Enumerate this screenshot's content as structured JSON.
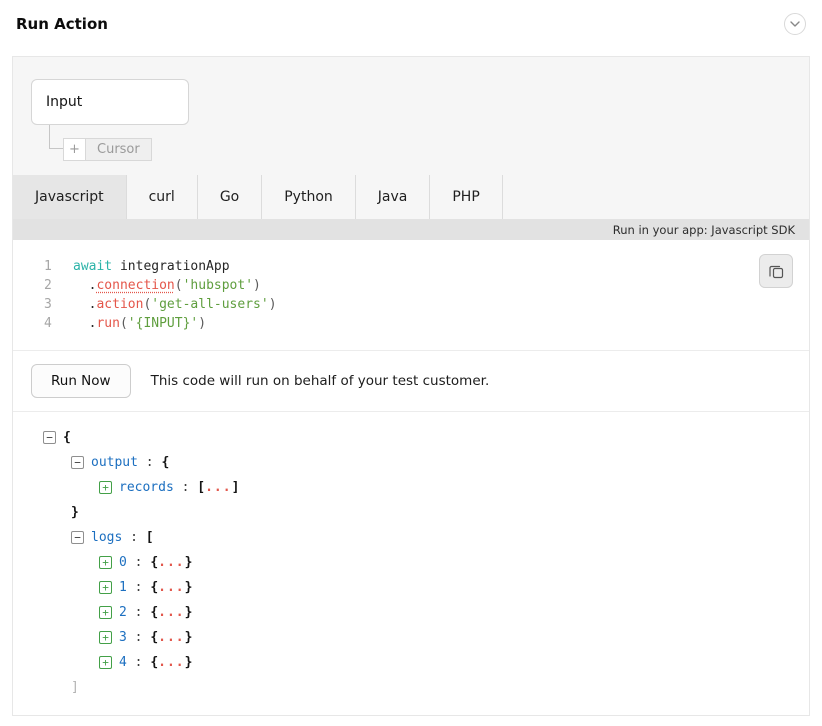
{
  "header": {
    "title": "Run Action"
  },
  "flow": {
    "input_label": "Input",
    "cursor_plus": "+",
    "cursor_label": "Cursor"
  },
  "tabs": [
    {
      "label": "Javascript",
      "active": true
    },
    {
      "label": "curl",
      "active": false
    },
    {
      "label": "Go",
      "active": false
    },
    {
      "label": "Python",
      "active": false
    },
    {
      "label": "Java",
      "active": false
    },
    {
      "label": "PHP",
      "active": false
    }
  ],
  "sdk_bar": {
    "label": "Run in your app: Javascript SDK"
  },
  "code": {
    "lines": [
      {
        "num": "1",
        "tokens": [
          {
            "type": "keyword",
            "text": "await "
          },
          {
            "type": "plain",
            "text": "integrationApp"
          }
        ]
      },
      {
        "num": "2",
        "tokens": [
          {
            "type": "plain",
            "text": "  ."
          },
          {
            "type": "method-underline",
            "text": "connection"
          },
          {
            "type": "punct",
            "text": "("
          },
          {
            "type": "string",
            "text": "'hubspot'"
          },
          {
            "type": "punct",
            "text": ")"
          }
        ]
      },
      {
        "num": "3",
        "tokens": [
          {
            "type": "plain",
            "text": "  ."
          },
          {
            "type": "method",
            "text": "action"
          },
          {
            "type": "punct",
            "text": "("
          },
          {
            "type": "string",
            "text": "'get-all-users'"
          },
          {
            "type": "punct",
            "text": ")"
          }
        ]
      },
      {
        "num": "4",
        "tokens": [
          {
            "type": "plain",
            "text": "  ."
          },
          {
            "type": "method",
            "text": "run"
          },
          {
            "type": "punct",
            "text": "("
          },
          {
            "type": "string",
            "text": "'{INPUT}'"
          },
          {
            "type": "punct",
            "text": ")"
          }
        ]
      }
    ]
  },
  "run": {
    "button_label": "Run Now",
    "note": "This code will run on behalf of your test customer."
  },
  "result_tree": {
    "rows": [
      {
        "indent": 0,
        "toggle": "minus",
        "segments": [
          {
            "type": "brace",
            "text": "{"
          }
        ]
      },
      {
        "indent": 1,
        "toggle": "minus",
        "segments": [
          {
            "type": "key",
            "text": "output"
          },
          {
            "type": "colon",
            "text": " : "
          },
          {
            "type": "brace",
            "text": "{"
          }
        ]
      },
      {
        "indent": 2,
        "toggle": "plus",
        "segments": [
          {
            "type": "key",
            "text": "records"
          },
          {
            "type": "colon",
            "text": " : "
          },
          {
            "type": "brace",
            "text": "["
          },
          {
            "type": "dots",
            "text": "..."
          },
          {
            "type": "brace",
            "text": "]"
          }
        ]
      },
      {
        "indent": 1,
        "toggle": "none",
        "segments": [
          {
            "type": "brace",
            "text": "}"
          }
        ]
      },
      {
        "indent": 1,
        "toggle": "minus",
        "segments": [
          {
            "type": "key",
            "text": "logs"
          },
          {
            "type": "colon",
            "text": " : "
          },
          {
            "type": "brace",
            "text": "["
          }
        ]
      },
      {
        "indent": 2,
        "toggle": "plus",
        "segments": [
          {
            "type": "key",
            "text": "0"
          },
          {
            "type": "colon",
            "text": " : "
          },
          {
            "type": "brace",
            "text": "{"
          },
          {
            "type": "dots",
            "text": "..."
          },
          {
            "type": "brace",
            "text": "}"
          }
        ]
      },
      {
        "indent": 2,
        "toggle": "plus",
        "segments": [
          {
            "type": "key",
            "text": "1"
          },
          {
            "type": "colon",
            "text": " : "
          },
          {
            "type": "brace",
            "text": "{"
          },
          {
            "type": "dots",
            "text": "..."
          },
          {
            "type": "brace",
            "text": "}"
          }
        ]
      },
      {
        "indent": 2,
        "toggle": "plus",
        "segments": [
          {
            "type": "key",
            "text": "2"
          },
          {
            "type": "colon",
            "text": " : "
          },
          {
            "type": "brace",
            "text": "{"
          },
          {
            "type": "dots",
            "text": "..."
          },
          {
            "type": "brace",
            "text": "}"
          }
        ]
      },
      {
        "indent": 2,
        "toggle": "plus",
        "segments": [
          {
            "type": "key",
            "text": "3"
          },
          {
            "type": "colon",
            "text": " : "
          },
          {
            "type": "brace",
            "text": "{"
          },
          {
            "type": "dots",
            "text": "..."
          },
          {
            "type": "brace",
            "text": "}"
          }
        ]
      },
      {
        "indent": 2,
        "toggle": "plus",
        "segments": [
          {
            "type": "key",
            "text": "4"
          },
          {
            "type": "colon",
            "text": " : "
          },
          {
            "type": "brace",
            "text": "{"
          },
          {
            "type": "dots",
            "text": "..."
          },
          {
            "type": "brace",
            "text": "}"
          }
        ]
      },
      {
        "indent": 1,
        "toggle": "none",
        "segments": [
          {
            "type": "brace-dim",
            "text": "]"
          }
        ]
      }
    ]
  },
  "colors": {
    "key_blue": "#1c6fc0",
    "dots_orange": "#e2574c",
    "string_green": "#5f9e3e",
    "keyword_teal": "#2bb3a8",
    "method_red": "#e4564a",
    "toggle_green": "#43a047"
  }
}
